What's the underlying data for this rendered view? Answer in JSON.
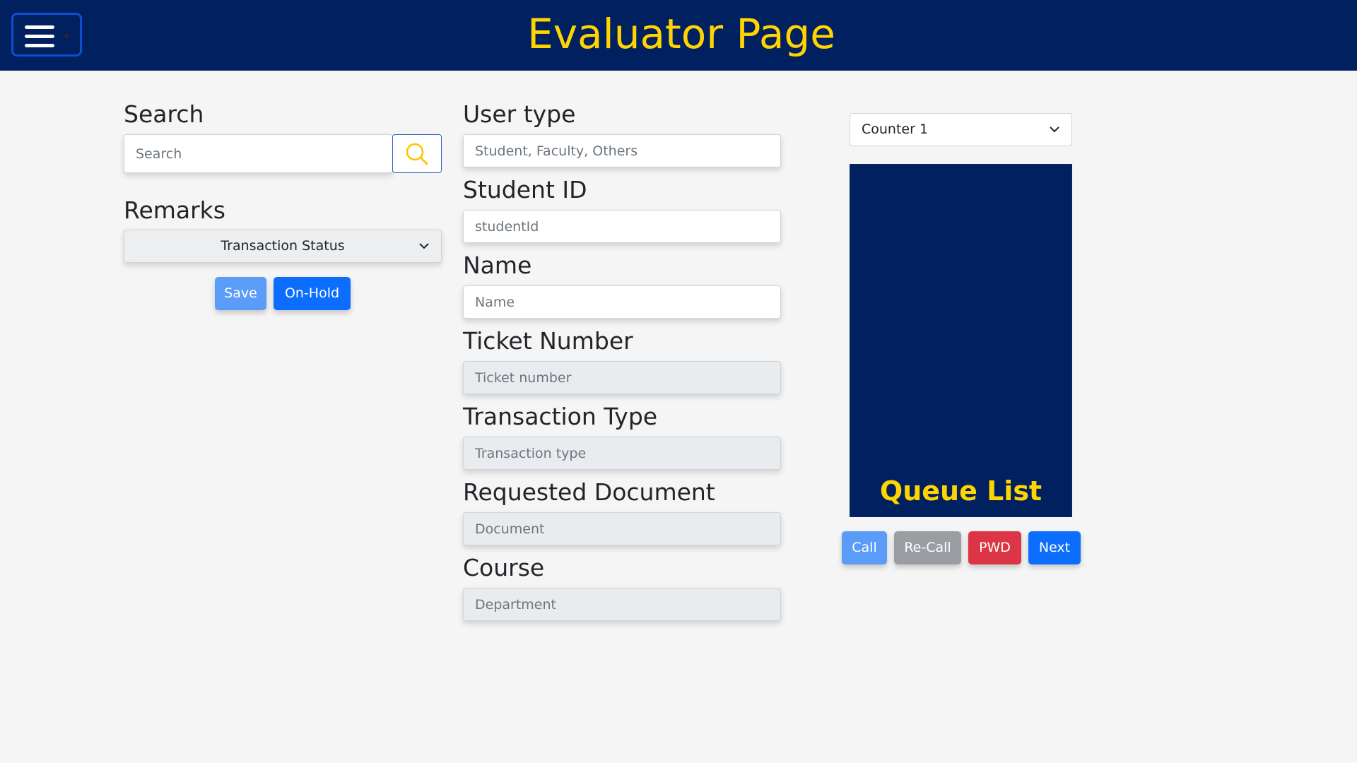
{
  "header": {
    "title": "Evaluator Page"
  },
  "left": {
    "search_label": "Search",
    "search_placeholder": "Search",
    "remarks_label": "Remarks",
    "remarks_select": "Transaction Status",
    "save_label": "Save",
    "onhold_label": "On-Hold"
  },
  "middle": {
    "user_type_label": "User type",
    "user_type_placeholder": "Student, Faculty, Others",
    "student_id_label": "Student ID",
    "student_id_placeholder": "studentId",
    "name_label": "Name",
    "name_placeholder": "Name",
    "ticket_label": "Ticket Number",
    "ticket_placeholder": "Ticket number",
    "transaction_label": "Transaction Type",
    "transaction_placeholder": "Transaction type",
    "document_label": "Requested Document",
    "document_placeholder": "Document",
    "course_label": "Course",
    "course_placeholder": "Department"
  },
  "right": {
    "counter_select": "Counter 1",
    "queue_title": "Queue List",
    "call_label": "Call",
    "recall_label": "Re-Call",
    "pwd_label": "PWD",
    "next_label": "Next"
  },
  "colors": {
    "header_bg": "#002060",
    "accent_yellow": "#ffd400",
    "primary": "#0d6efd",
    "primary_light": "#5a9cf8",
    "secondary": "#9a9ea3",
    "danger": "#dc3545"
  },
  "icons": [
    "hamburger-menu-icon",
    "search-icon",
    "chevron-down-icon"
  ]
}
